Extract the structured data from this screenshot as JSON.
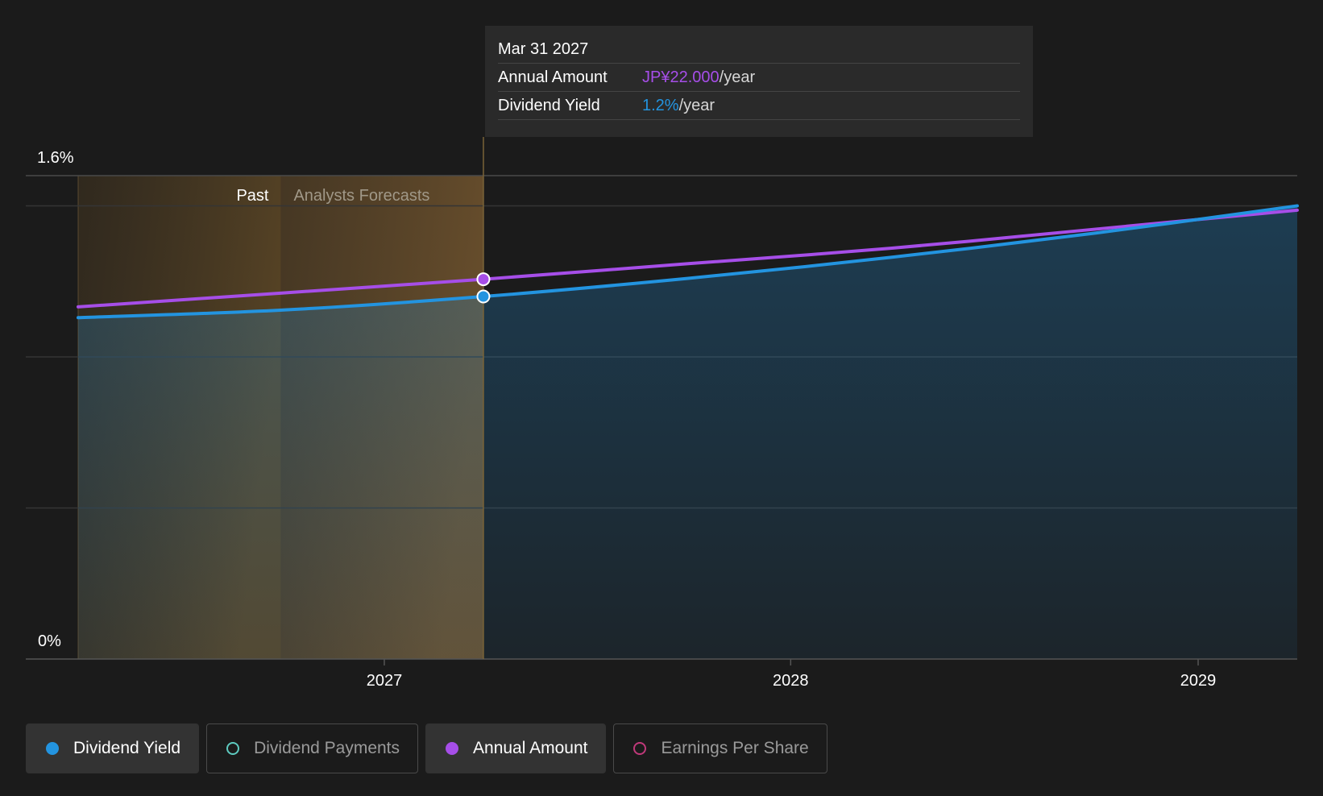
{
  "tooltip": {
    "date": "Mar 31 2027",
    "rows": [
      {
        "label": "Annual Amount",
        "value": "JP¥22.000",
        "unit": "/year",
        "color": "#a64ee8"
      },
      {
        "label": "Dividend Yield",
        "value": "1.2%",
        "unit": "/year",
        "color": "#2394e0"
      }
    ]
  },
  "regions": {
    "past_label": "Past",
    "forecast_label": "Analysts Forecasts"
  },
  "legend": [
    {
      "label": "Dividend Yield",
      "color": "#2394e0",
      "active": true,
      "dot_style": "filled",
      "icon": "filled-circle"
    },
    {
      "label": "Dividend Payments",
      "color": "#5ecbc0",
      "active": false,
      "dot_style": "outline",
      "icon": "hollow-circle"
    },
    {
      "label": "Annual Amount",
      "color": "#a64ee8",
      "active": true,
      "dot_style": "filled",
      "icon": "filled-circle"
    },
    {
      "label": "Earnings Per Share",
      "color": "#c0397a",
      "active": false,
      "dot_style": "outline",
      "icon": "hollow-circle"
    }
  ],
  "chart_data": {
    "type": "area",
    "title": "",
    "xlabel": "",
    "ylabel": "",
    "y_tick_labels": [
      "1.6%",
      "0%"
    ],
    "ylim": [
      0,
      1.6
    ],
    "xlim": [
      "2026-04-01",
      "2029-03-31"
    ],
    "x_tick_labels": [
      {
        "date": "2027-01-01",
        "label": "2027"
      },
      {
        "date": "2028-01-01",
        "label": "2028"
      },
      {
        "date": "2029-01-01",
        "label": "2029"
      }
    ],
    "past_region": [
      "2026-04-01",
      "2026-09-30"
    ],
    "forecast_region": [
      "2026-09-30",
      "2027-03-31"
    ],
    "highlight_date": "2027-03-31",
    "grid": true,
    "legend_position": "bottom",
    "series": [
      {
        "name": "Dividend Yield",
        "color": "#2394e0",
        "unit": "%",
        "points": [
          {
            "x": "2026-04-01",
            "y": 1.13
          },
          {
            "x": "2026-10-01",
            "y": 1.155
          },
          {
            "x": "2027-03-31",
            "y": 1.2
          },
          {
            "x": "2027-10-01",
            "y": 1.26
          },
          {
            "x": "2028-04-01",
            "y": 1.33
          },
          {
            "x": "2028-10-01",
            "y": 1.41
          },
          {
            "x": "2029-03-31",
            "y": 1.5
          }
        ]
      },
      {
        "name": "Annual Amount",
        "color": "#a64ee8",
        "unit": "JP¥",
        "points": [
          {
            "x": "2026-04-01",
            "y": 20.4
          },
          {
            "x": "2026-10-01",
            "y": 21.2
          },
          {
            "x": "2027-03-31",
            "y": 22.0
          },
          {
            "x": "2027-10-01",
            "y": 22.9
          },
          {
            "x": "2028-04-01",
            "y": 23.8
          },
          {
            "x": "2028-10-01",
            "y": 24.9
          },
          {
            "x": "2029-03-31",
            "y": 26.0
          }
        ]
      }
    ]
  }
}
